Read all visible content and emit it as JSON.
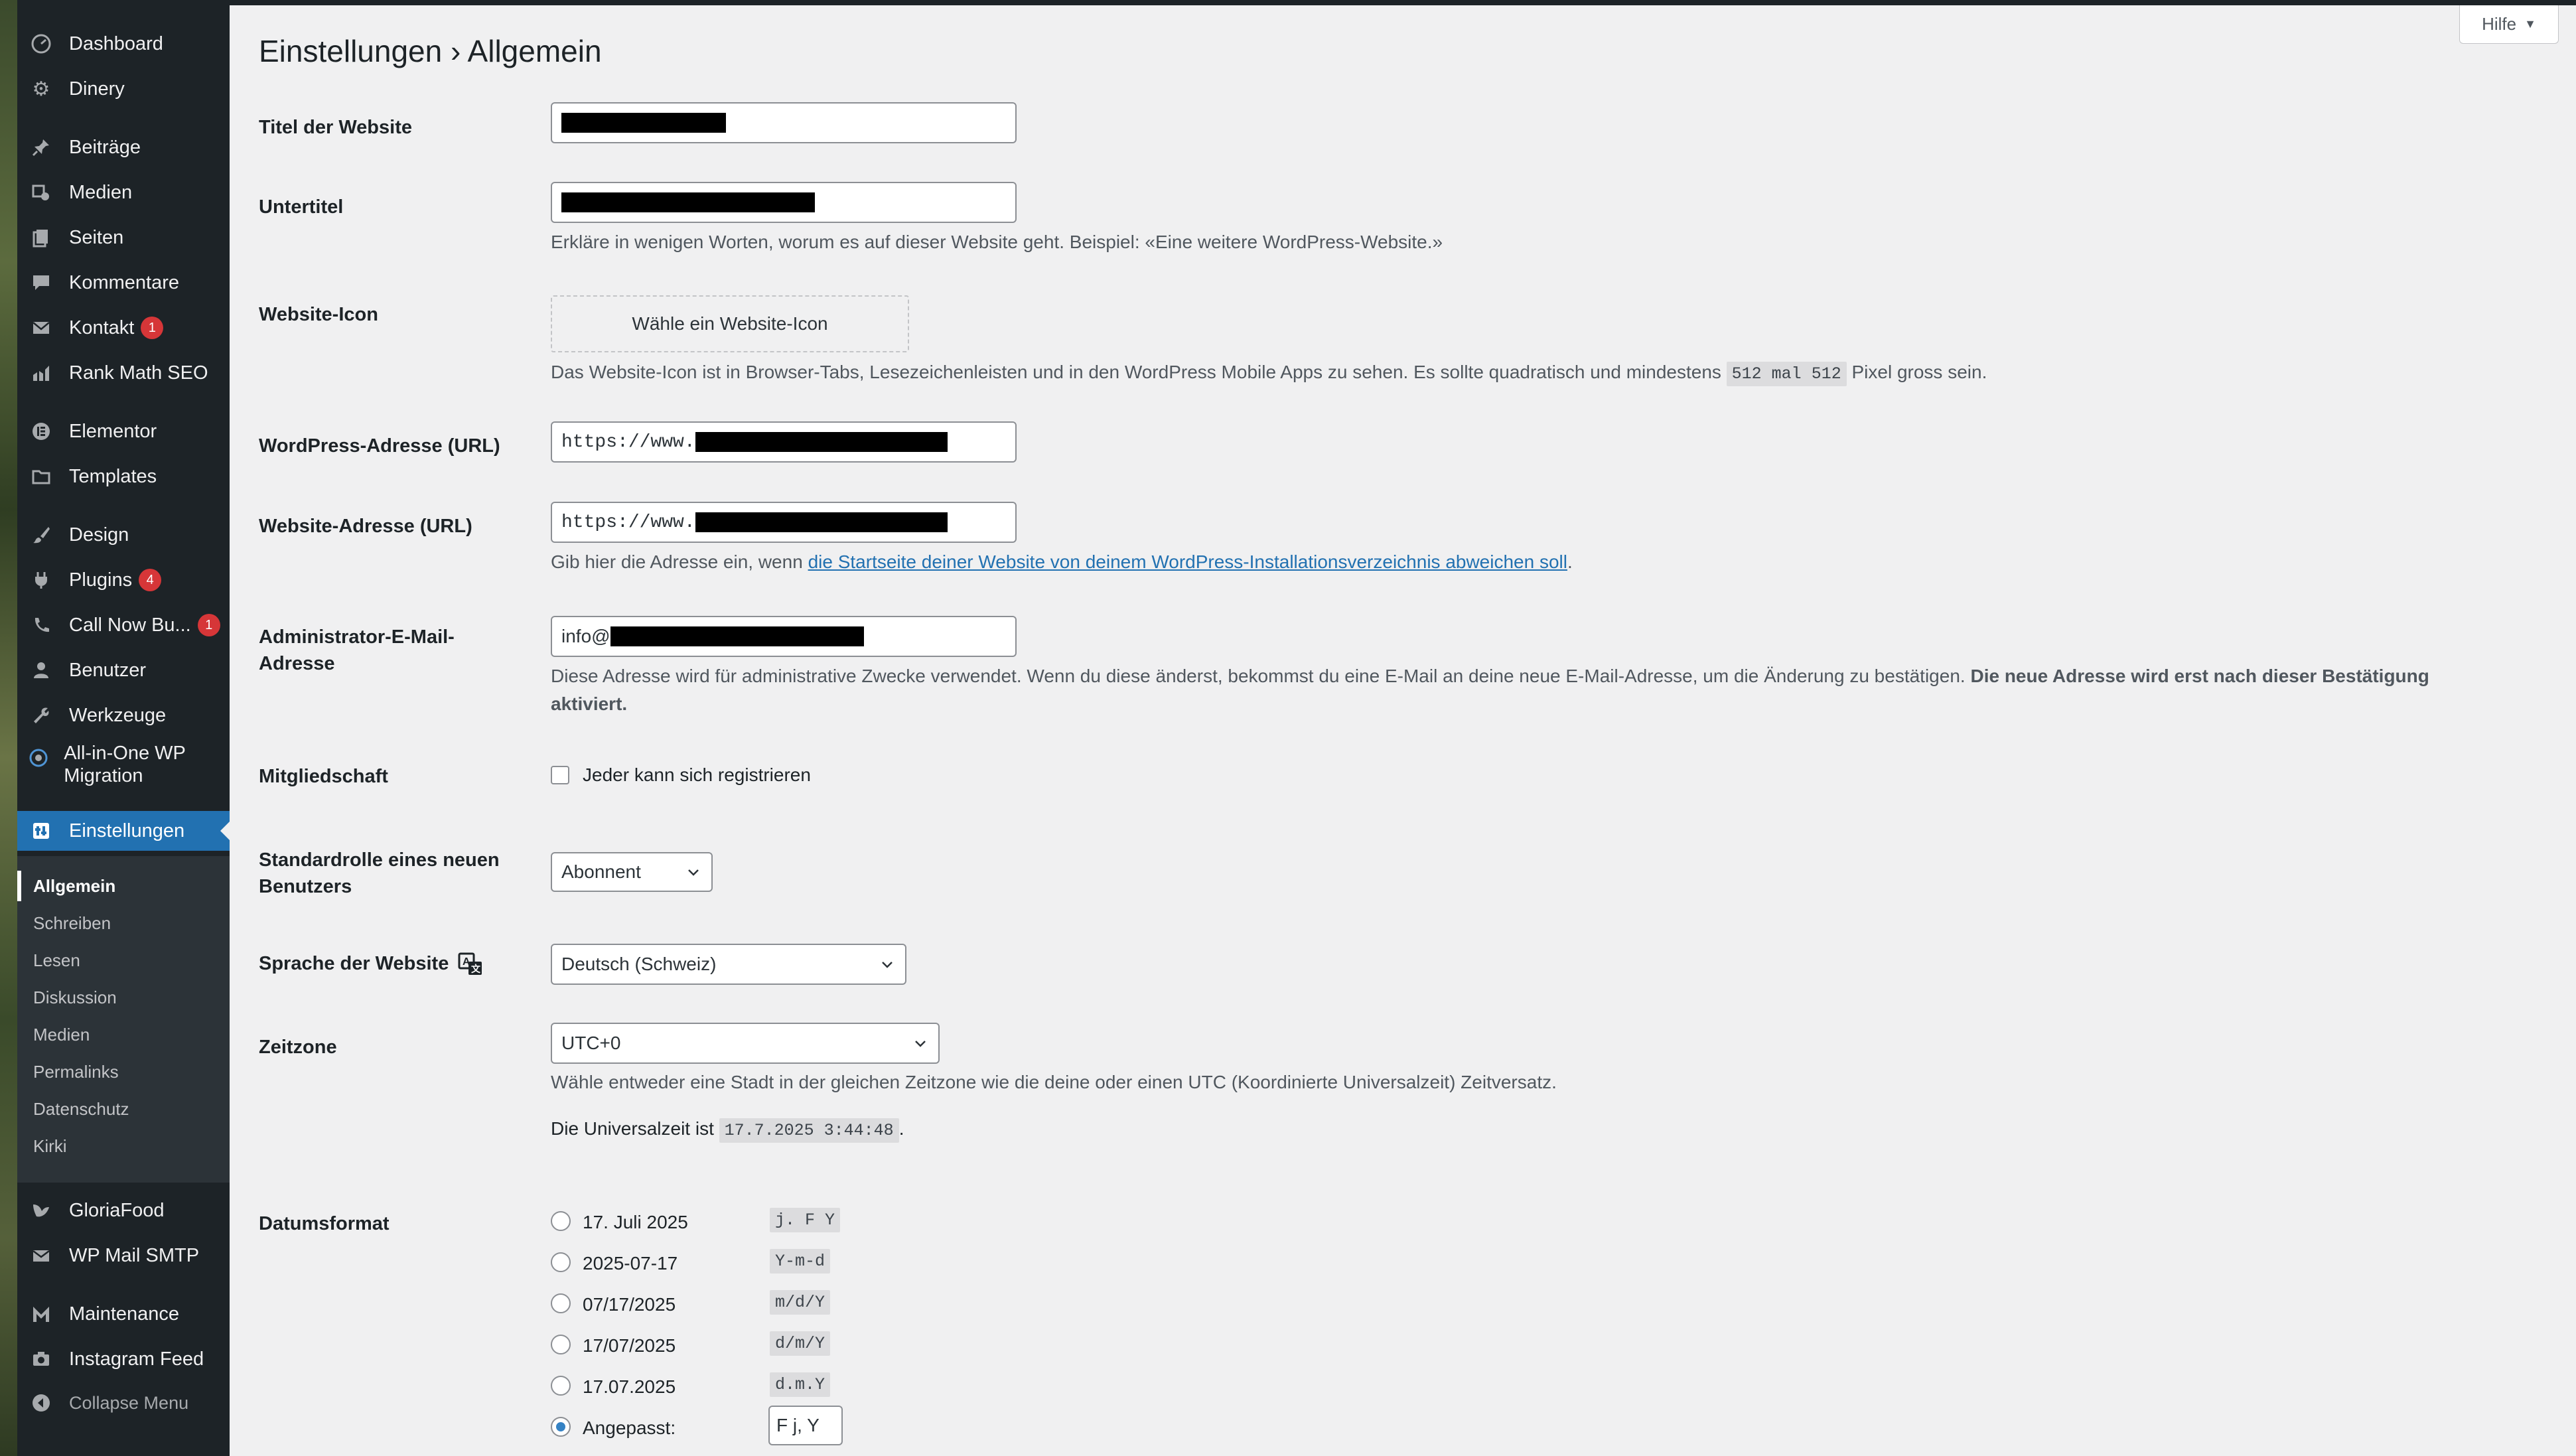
{
  "sidebar": {
    "items": [
      {
        "label": "Dashboard",
        "icon": "dashboard-icon"
      },
      {
        "label": "Dinery",
        "icon": "gear-icon"
      },
      {
        "label": "Beiträge",
        "icon": "pin-icon"
      },
      {
        "label": "Medien",
        "icon": "media-icon"
      },
      {
        "label": "Seiten",
        "icon": "pages-icon"
      },
      {
        "label": "Kommentare",
        "icon": "comment-icon"
      },
      {
        "label": "Kontakt",
        "icon": "mail-icon",
        "badge": "1"
      },
      {
        "label": "Rank Math SEO",
        "icon": "chart-icon"
      },
      {
        "label": "Elementor",
        "icon": "elementor-icon"
      },
      {
        "label": "Templates",
        "icon": "folder-icon"
      },
      {
        "label": "Design",
        "icon": "brush-icon"
      },
      {
        "label": "Plugins",
        "icon": "plugin-icon",
        "badge": "4"
      },
      {
        "label": "Call Now Bu...",
        "icon": "phone-icon",
        "badge": "1"
      },
      {
        "label": "Benutzer",
        "icon": "user-icon"
      },
      {
        "label": "Werkzeuge",
        "icon": "wrench-icon"
      },
      {
        "label": "All-in-One WP Migration",
        "icon": "migration-icon"
      },
      {
        "label": "Einstellungen",
        "icon": "settings-icon"
      },
      {
        "label": "GloriaFood",
        "icon": "leaf-icon"
      },
      {
        "label": "WP Mail SMTP",
        "icon": "smtp-icon"
      },
      {
        "label": "Maintenance",
        "icon": "m-logo-icon"
      },
      {
        "label": "Instagram Feed",
        "icon": "camera-icon"
      }
    ],
    "submenu": [
      "Allgemein",
      "Schreiben",
      "Lesen",
      "Diskussion",
      "Medien",
      "Permalinks",
      "Datenschutz",
      "Kirki"
    ],
    "collapse": "Collapse Menu"
  },
  "header": {
    "help": "Hilfe"
  },
  "page": {
    "title": "Einstellungen › Allgemein"
  },
  "fields": {
    "site_title": {
      "label": "Titel der Website"
    },
    "tagline": {
      "label": "Untertitel",
      "desc": "Erkläre in wenigen Worten, worum es auf dieser Website geht. Beispiel: «Eine weitere WordPress-Website.»"
    },
    "site_icon": {
      "label": "Website-Icon",
      "button": "Wähle ein Website-Icon",
      "desc_before": "Das Website-Icon ist in Browser-Tabs, Lesezeichenleisten und in den WordPress Mobile Apps zu sehen. Es sollte quadratisch und mindestens",
      "code": "512 mal 512",
      "desc_after": "Pixel gross sein."
    },
    "wp_url": {
      "label": "WordPress-Adresse (URL)",
      "value_prefix": "https://www."
    },
    "site_url": {
      "label": "Website-Adresse (URL)",
      "value_prefix": "https://www.",
      "desc_before": "Gib hier die Adresse ein, wenn",
      "desc_link": "die Startseite deiner Website von deinem WordPress-Installationsverzeichnis abweichen soll",
      "desc_after": "."
    },
    "admin_email": {
      "label": "Administrator-E-Mail-Adresse",
      "value_prefix": "info@",
      "desc": "Diese Adresse wird für administrative Zwecke verwendet. Wenn du diese änderst, bekommst du eine E-Mail an deine neue E-Mail-Adresse, um die Änderung zu bestätigen.",
      "desc_bold_1": "Die neue Adresse wird erst nach dieser Bestätigung",
      "desc_bold_2": "aktiviert."
    },
    "membership": {
      "label": "Mitgliedschaft",
      "checkbox": "Jeder kann sich registrieren",
      "checked": false
    },
    "default_role": {
      "label": "Standardrolle eines neuen Benutzers",
      "value": "Abonnent"
    },
    "language": {
      "label": "Sprache der Website",
      "value": "Deutsch (Schweiz)"
    },
    "timezone": {
      "label": "Zeitzone",
      "value": "UTC+0",
      "desc": "Wähle entweder eine Stadt in der gleichen Zeitzone wie die deine oder einen UTC (Koordinierte Universalzeit) Zeitversatz.",
      "utc_before": "Die Universalzeit ist",
      "utc_value": "17.7.2025 3:44:48",
      "utc_after": "."
    },
    "date_format": {
      "label": "Datumsformat",
      "options": [
        {
          "label": "17. Juli 2025",
          "code": "j. F Y",
          "checked": false
        },
        {
          "label": "2025-07-17",
          "code": "Y-m-d",
          "checked": false
        },
        {
          "label": "07/17/2025",
          "code": "m/d/Y",
          "checked": false
        },
        {
          "label": "17/07/2025",
          "code": "d/m/Y",
          "checked": false
        },
        {
          "label": "17.07.2025",
          "code": "d.m.Y",
          "checked": false
        }
      ],
      "custom_label": "Angepasst:",
      "custom_value": "F j, Y",
      "custom_checked": true
    }
  },
  "colors": {
    "sidebar_bg": "#1d2327",
    "accent": "#2271b1",
    "badge": "#d63638",
    "content_bg": "#f0f0f1"
  }
}
